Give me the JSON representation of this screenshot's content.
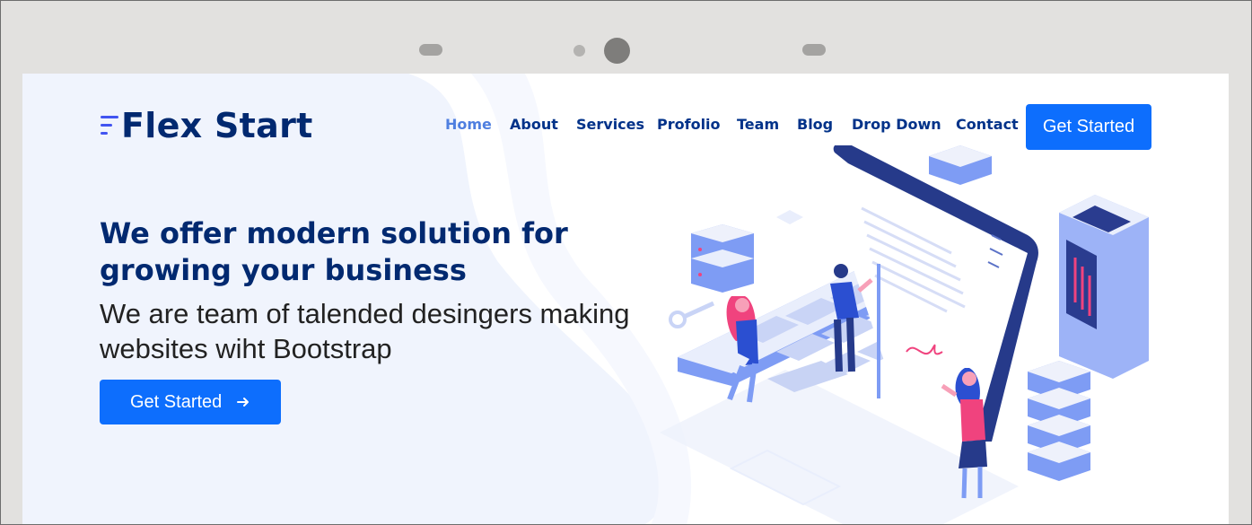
{
  "brand": {
    "name": "Flex Start"
  },
  "nav": {
    "items": [
      {
        "label": "Home",
        "active": true
      },
      {
        "label": "About"
      },
      {
        "label": "Services"
      },
      {
        "label": "Profolio"
      },
      {
        "label": "Team"
      },
      {
        "label": "Blog"
      },
      {
        "label": "Drop Down"
      },
      {
        "label": "Contact"
      }
    ],
    "cta_label": "Get Started"
  },
  "hero": {
    "title": "We offer modern solution for growing your business",
    "subtitle": "We are team of talended desingers making websites wiht Bootstrap",
    "cta_label": "Get Started",
    "cta_icon": "arrow-right-icon",
    "illustration": "isometric-laptop-team-illustration"
  },
  "colors": {
    "primary": "#0d6efd",
    "heading": "#012970",
    "nav_text": "#013289",
    "nav_active": "#4f7fe0",
    "hero_bg": "#f0f4fd"
  }
}
